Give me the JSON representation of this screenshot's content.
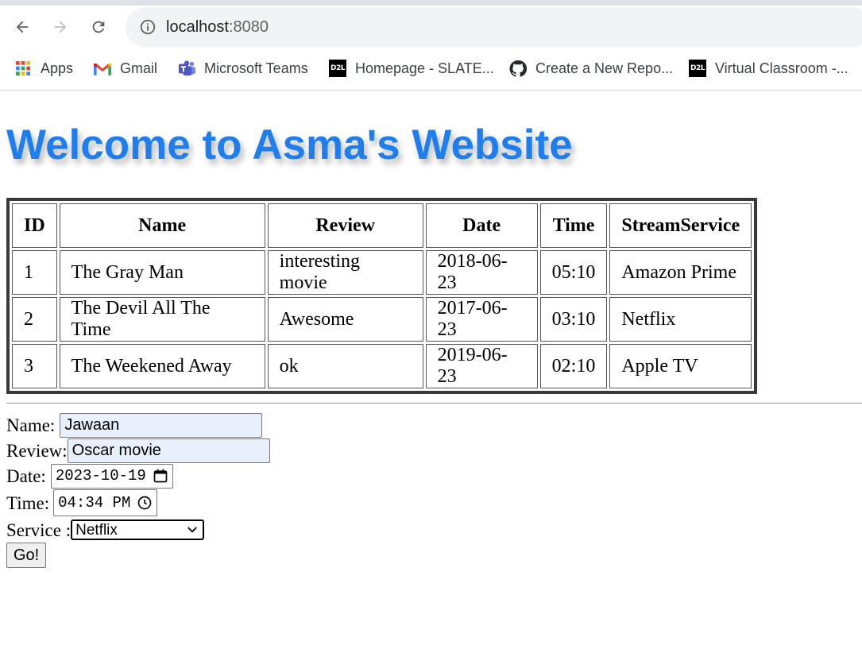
{
  "browser": {
    "url_host": "localhost",
    "url_port": ":8080",
    "bookmarks": [
      {
        "label": "Apps",
        "icon": "apps-grid-icon"
      },
      {
        "label": "Gmail",
        "icon": "gmail-icon"
      },
      {
        "label": "Microsoft Teams",
        "icon": "teams-icon"
      },
      {
        "label": "Homepage - SLATE...",
        "icon": "d2l-icon"
      },
      {
        "label": "Create a New Repo...",
        "icon": "github-icon"
      },
      {
        "label": "Virtual Classroom -...",
        "icon": "d2l-icon"
      }
    ],
    "d2l_text": "D2L"
  },
  "page": {
    "title": "Welcome to Asma's Website",
    "title_color": "#1e7ef0"
  },
  "table": {
    "headers": [
      "ID",
      "Name",
      "Review",
      "Date",
      "Time",
      "StreamService"
    ],
    "rows": [
      [
        "1",
        "The Gray Man",
        "interesting movie",
        "2018-06-23",
        "05:10",
        "Amazon Prime"
      ],
      [
        "2",
        "The Devil All The Time",
        "Awesome",
        "2017-06-23",
        "03:10",
        "Netflix"
      ],
      [
        "3",
        "The Weekened Away",
        "ok",
        "2019-06-23",
        "02:10",
        "Apple TV"
      ]
    ]
  },
  "form": {
    "name_label": "Name:",
    "name_value": "Jawaan",
    "review_label": "Review:",
    "review_value": "Oscar movie",
    "date_label": "Date:",
    "date_value": "2023-10-19",
    "time_label": "Time:",
    "time_value": "04:34 PM",
    "service_label": "Service :",
    "service_value": "Netflix",
    "submit_label": "Go!"
  }
}
